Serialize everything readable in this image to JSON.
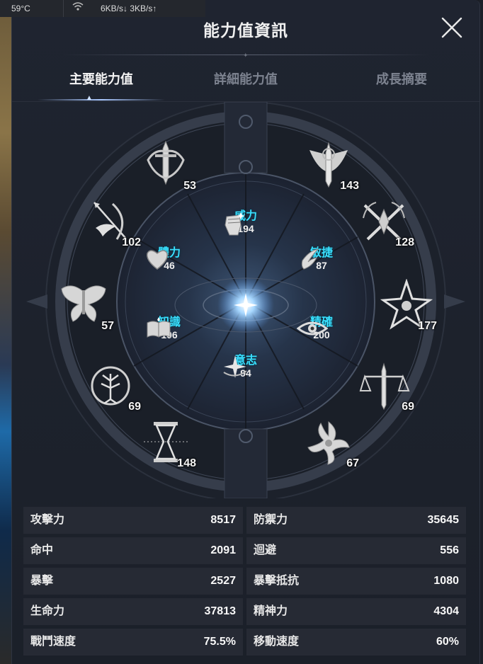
{
  "system_bar": {
    "temperature": "59°C",
    "network_speed": "6KB/s↓  3KB/s↑"
  },
  "window": {
    "title": "能力值資訊",
    "close_icon": "close-icon"
  },
  "tabs": [
    {
      "label": "主要能力值",
      "active": true
    },
    {
      "label": "詳細能力值",
      "active": false
    },
    {
      "label": "成長摘要",
      "active": false
    }
  ],
  "outer_stats": [
    {
      "icon": "sword-crest-icon",
      "value": "53"
    },
    {
      "icon": "winged-blade-icon",
      "value": "143"
    },
    {
      "icon": "bird-bow-icon",
      "value": "102"
    },
    {
      "icon": "crossed-blades-icon",
      "value": "128"
    },
    {
      "icon": "butterfly-icon",
      "value": "57"
    },
    {
      "icon": "star-emblem-icon",
      "value": "177"
    },
    {
      "icon": "tree-wreath-icon",
      "value": "69"
    },
    {
      "icon": "scales-sword-icon",
      "value": "69"
    },
    {
      "icon": "hourglass-icon",
      "value": "148"
    },
    {
      "icon": "flame-swirl-icon",
      "value": "67"
    }
  ],
  "inner_stats": [
    {
      "icon": "fist-icon",
      "name": "威力",
      "value": "194"
    },
    {
      "icon": "heart-icon",
      "name": "體力",
      "value": "46"
    },
    {
      "icon": "wing-feather-icon",
      "name": "敏捷",
      "value": "87"
    },
    {
      "icon": "book-icon",
      "name": "知識",
      "value": "106"
    },
    {
      "icon": "eye-icon",
      "name": "精確",
      "value": "200"
    },
    {
      "icon": "sparkle-icon",
      "name": "意志",
      "value": "94"
    }
  ],
  "combat_stats": [
    {
      "label": "攻擊力",
      "value": "8517"
    },
    {
      "label": "防禦力",
      "value": "35645"
    },
    {
      "label": "命中",
      "value": "2091"
    },
    {
      "label": "迴避",
      "value": "556"
    },
    {
      "label": "暴擊",
      "value": "2527"
    },
    {
      "label": "暴擊抵抗",
      "value": "1080"
    },
    {
      "label": "生命力",
      "value": "37813"
    },
    {
      "label": "精神力",
      "value": "4304"
    },
    {
      "label": "戰鬥速度",
      "value": "75.5%"
    },
    {
      "label": "移動速度",
      "value": "60%"
    }
  ],
  "colors": {
    "accent_cyan": "#39e0ff",
    "panel_bg": "#1f2430",
    "cell_bg": "#262a34"
  }
}
